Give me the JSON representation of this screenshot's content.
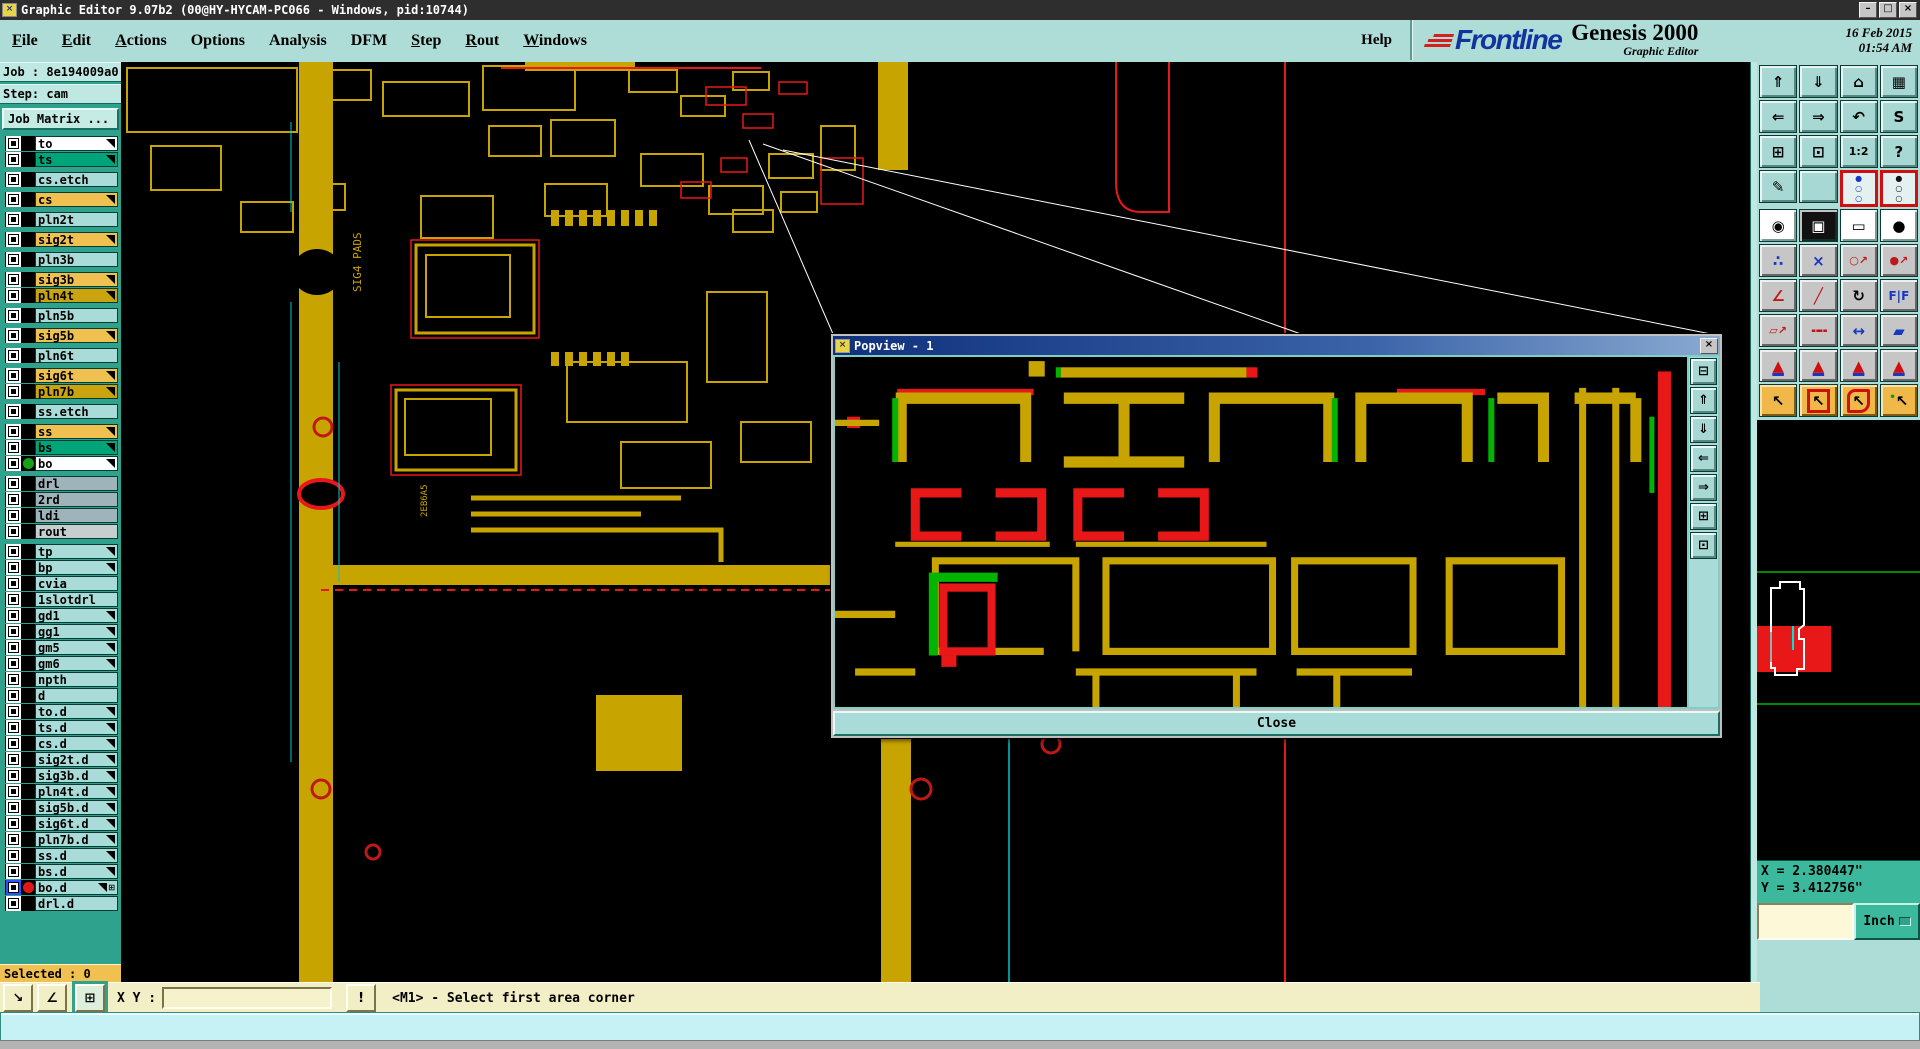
{
  "window": {
    "title": "Graphic Editor 9.07b2 (00@HY-HYCAM-PC066 - Windows, pid:10744)",
    "controls": [
      {
        "name": "minimize-button",
        "glyph": "–"
      },
      {
        "name": "maximize-button",
        "glyph": "□"
      },
      {
        "name": "close-button",
        "glyph": "×"
      }
    ]
  },
  "menu": {
    "items": [
      {
        "label": "File",
        "u": 0
      },
      {
        "label": "Edit",
        "u": 0
      },
      {
        "label": "Actions",
        "u": 0
      },
      {
        "label": "Options",
        "u": null
      },
      {
        "label": "Analysis",
        "u": null
      },
      {
        "label": "DFM",
        "u": null
      },
      {
        "label": "Step",
        "u": 0
      },
      {
        "label": "Rout",
        "u": 0
      },
      {
        "label": "Windows",
        "u": 0
      }
    ],
    "help": "Help"
  },
  "header": {
    "brand": "Frontline",
    "product": "Genesis 2000",
    "app": "Graphic Editor",
    "date": "16 Feb 2015",
    "time": "01:54 AM"
  },
  "sidebar": {
    "job_label": "Job : 8e194009a0",
    "step_label": "Step: cam",
    "job_matrix": "Job Matrix ...",
    "selected": "Selected : 0",
    "layers": [
      {
        "name": "to",
        "color": "white",
        "arrow": true
      },
      {
        "name": "ts",
        "color": "green",
        "arrow": true
      },
      {
        "name": "cs.etch",
        "color": "cyan",
        "gap": true
      },
      {
        "name": "cs",
        "color": "orange",
        "arrow": true,
        "gap": true
      },
      {
        "name": "pln2t",
        "color": "cyan",
        "gap": true
      },
      {
        "name": "sig2t",
        "color": "orange",
        "arrow": true,
        "gap": true
      },
      {
        "name": "pln3b",
        "color": "cyan",
        "gap": true
      },
      {
        "name": "sig3b",
        "color": "orange",
        "arrow": true,
        "gap": true
      },
      {
        "name": "pln4t",
        "color": "olive",
        "arrow": true
      },
      {
        "name": "pln5b",
        "color": "cyan",
        "gap": true
      },
      {
        "name": "sig5b",
        "color": "orange",
        "arrow": true,
        "gap": true
      },
      {
        "name": "pln6t",
        "color": "cyan",
        "gap": true
      },
      {
        "name": "sig6t",
        "color": "orange",
        "arrow": true,
        "gap": true
      },
      {
        "name": "pln7b",
        "color": "olive",
        "arrow": true
      },
      {
        "name": "ss.etch",
        "color": "cyan",
        "gap": true
      },
      {
        "name": "ss",
        "color": "orange",
        "arrow": true,
        "gap": true
      },
      {
        "name": "bs",
        "color": "green",
        "arrow": true
      },
      {
        "name": "bo",
        "color": "white",
        "arrow": true,
        "dot": "g"
      },
      {
        "name": "drl",
        "color": "gray",
        "gap": true
      },
      {
        "name": "2rd",
        "color": "gray"
      },
      {
        "name": "ldi",
        "color": "gray"
      },
      {
        "name": "rout",
        "color": "lightgray"
      },
      {
        "name": "tp",
        "color": "cyan",
        "arrow": true,
        "gap": true
      },
      {
        "name": "bp",
        "color": "cyan",
        "arrow": true
      },
      {
        "name": "cvia",
        "color": "cyan"
      },
      {
        "name": "1slotdrl",
        "color": "cyan"
      },
      {
        "name": "gd1",
        "color": "cyan",
        "arrow": true
      },
      {
        "name": "gg1",
        "color": "cyan",
        "arrow": true
      },
      {
        "name": "gm5",
        "color": "cyan",
        "arrow": true
      },
      {
        "name": "gm6",
        "color": "cyan",
        "arrow": true
      },
      {
        "name": "npth",
        "color": "cyan"
      },
      {
        "name": "d",
        "color": "cyan"
      },
      {
        "name": "to.d",
        "color": "cyan",
        "arrow": true
      },
      {
        "name": "ts.d",
        "color": "cyan",
        "arrow": true
      },
      {
        "name": "cs.d",
        "color": "cyan",
        "arrow": true
      },
      {
        "name": "sig2t.d",
        "color": "cyan",
        "arrow": true
      },
      {
        "name": "sig3b.d",
        "color": "cyan",
        "arrow": true
      },
      {
        "name": "pln4t.d",
        "color": "cyan",
        "arrow": true
      },
      {
        "name": "sig5b.d",
        "color": "cyan",
        "arrow": true
      },
      {
        "name": "sig6t.d",
        "color": "cyan",
        "arrow": true
      },
      {
        "name": "pln7b.d",
        "color": "cyan",
        "arrow": true
      },
      {
        "name": "ss.d",
        "color": "cyan",
        "arrow": true
      },
      {
        "name": "bs.d",
        "color": "cyan",
        "arrow": true
      },
      {
        "name": "bo.d",
        "color": "cyan",
        "arrow": true,
        "dot": "r",
        "selected": true,
        "extra": "⊞"
      },
      {
        "name": "drl.d",
        "color": "cyan"
      }
    ]
  },
  "toolbar_right": {
    "buttons": [
      {
        "name": "paste-up-button",
        "glyph": "⇑",
        "cls": ""
      },
      {
        "name": "paste-down-button",
        "glyph": "⇓",
        "cls": ""
      },
      {
        "name": "home-view-button",
        "glyph": "⌂",
        "cls": ""
      },
      {
        "name": "window-xy-button",
        "glyph": "▦",
        "cls": ""
      },
      {
        "name": "pan-left-button",
        "glyph": "⇐",
        "cls": ""
      },
      {
        "name": "pan-right-button",
        "glyph": "⇒",
        "cls": ""
      },
      {
        "name": "previous-view-button",
        "glyph": "↶",
        "cls": ""
      },
      {
        "name": "s-route-button",
        "glyph": "S",
        "cls": ""
      },
      {
        "name": "zoom-fit-button",
        "glyph": "⊞",
        "cls": ""
      },
      {
        "name": "zoom-center-button",
        "glyph": "⊡",
        "cls": ""
      },
      {
        "name": "scale-1-2-button",
        "glyph": "1:2",
        "cls": "small"
      },
      {
        "name": "help-query-button",
        "glyph": "?",
        "cls": ""
      },
      {
        "name": "setup-tools-button",
        "glyph": "✎",
        "cls": ""
      },
      {
        "name": "grid-button",
        "glyph": "",
        "cls": "grid-icon"
      },
      {
        "name": "layer-traffic-blue-button",
        "glyph": "●○○",
        "cls": "traffic traffic-blue"
      },
      {
        "name": "layer-traffic-dark-button",
        "glyph": "●○○",
        "cls": "traffic traffic-dark"
      },
      {
        "name": "select-entity-button",
        "glyph": "◉",
        "cls": "white"
      },
      {
        "name": "select-area-button",
        "glyph": "▣",
        "cls": "dark"
      },
      {
        "name": "ruler-button",
        "glyph": "▭",
        "cls": "white"
      },
      {
        "name": "select-pad-button",
        "glyph": "●",
        "cls": "white"
      },
      {
        "name": "select-net-button",
        "glyph": "∴",
        "cls": "gray blue"
      },
      {
        "name": "unselect-button",
        "glyph": "×",
        "cls": "gray blue"
      },
      {
        "name": "copy-entity-button",
        "glyph": "○↗",
        "cls": "gray reddot small"
      },
      {
        "name": "move-entity-button",
        "glyph": "●↗",
        "cls": "gray reddot small"
      },
      {
        "name": "angle-measure-button",
        "glyph": "∠",
        "cls": "gray redblue"
      },
      {
        "name": "slope-measure-button",
        "glyph": "╱",
        "cls": "gray redblue"
      },
      {
        "name": "rotate-button",
        "glyph": "↻",
        "cls": "gray"
      },
      {
        "name": "mirror-button",
        "glyph": "F|F",
        "cls": "gray mirror"
      },
      {
        "name": "copy-to-layer-button",
        "glyph": "▱↗",
        "cls": "gray redblue small"
      },
      {
        "name": "dashed-line-button",
        "glyph": "╍╍",
        "cls": "gray redline"
      },
      {
        "name": "measure-width-button",
        "glyph": "↔",
        "cls": "gray blue"
      },
      {
        "name": "surface-union-button",
        "glyph": "▰",
        "cls": "gray blue"
      },
      {
        "name": "triangle-plain-button",
        "glyph": "▲",
        "cls": "gray tri"
      },
      {
        "name": "triangle-peak-button",
        "glyph": "▲",
        "cls": "gray tri"
      },
      {
        "name": "triangle-wide-button",
        "glyph": "▲",
        "cls": "gray tri"
      },
      {
        "name": "triangle-ticks-button",
        "glyph": "▲",
        "cls": "gray tri"
      },
      {
        "name": "cursor-select-button",
        "glyph": "↖",
        "cls": "orange"
      },
      {
        "name": "cursor-frame-button",
        "glyph": "↖",
        "cls": "orange framed"
      },
      {
        "name": "cursor-lasso-button",
        "glyph": "↖",
        "cls": "orange lassoed"
      },
      {
        "name": "cursor-path-button",
        "glyph": "↖",
        "cls": "orange pathed"
      }
    ]
  },
  "popview": {
    "title": "Popview - 1",
    "close_x": "×",
    "close": "Close",
    "side_buttons": [
      {
        "name": "popview-detach-button",
        "glyph": "⊟"
      },
      {
        "name": "popview-zoom-in-button",
        "glyph": "⇑"
      },
      {
        "name": "popview-zoom-out-button",
        "glyph": "⇓"
      },
      {
        "name": "popview-pan-left-button",
        "glyph": "⇐"
      },
      {
        "name": "popview-pan-right-button",
        "glyph": "⇒"
      },
      {
        "name": "popview-fit-button",
        "glyph": "⊞"
      },
      {
        "name": "popview-center-button",
        "glyph": "⊡"
      }
    ]
  },
  "statusbar": {
    "buttons": [
      {
        "name": "resize-diagonal-button",
        "glyph": "↘"
      },
      {
        "name": "angle-snap-button",
        "glyph": "∠"
      },
      {
        "name": "grid-toggle-button",
        "glyph": "⊞",
        "cls": "active"
      }
    ],
    "xy_label": "X Y :",
    "xy_value": "",
    "alert_button": {
      "name": "alert-button",
      "glyph": "!"
    },
    "prompt": "<M1> - Select first area corner"
  },
  "coords": {
    "x": "X = 2.380447\"",
    "y": "Y = 3.412756\"",
    "units": "Inch"
  },
  "pcb_text": {
    "vertical_label": "SIG4 PADS",
    "part_label": "2EB6A5"
  },
  "colors": {
    "panel_teal": "#aedcd6",
    "sidebar_teal": "#2ea28c",
    "layer_orange": "#f0c050",
    "layer_olive": "#c9a40e",
    "layer_green": "#00a478",
    "layer_cyan": "#a9dcd8",
    "trace_gold": "#c8a400",
    "trace_red": "#e81818",
    "highlight_green": "#00b400",
    "cream": "#f2eec6",
    "xy_green": "#3cb89c",
    "popview_title_blue": "#10307c"
  }
}
